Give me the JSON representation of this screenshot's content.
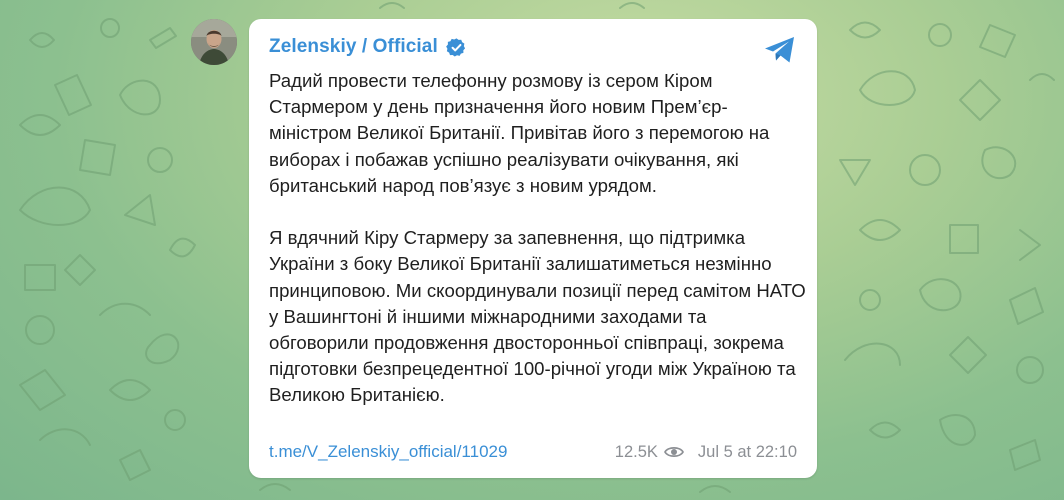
{
  "channel": {
    "name": "Zelenskiy / Official",
    "verified": true,
    "avatar_icon": "profile-photo",
    "accent_color": "#3a8fd6"
  },
  "post": {
    "paragraphs": [
      "Радий провести телефонну розмову із сером Кіром Стармером у день призначення його новим Прем’єр-міністром Великої Британії. Привітав його з перемогою на виборах і побажав успішно реалізувати очікування, які британський народ пов’язує з новим урядом.",
      "Я вдячний Кіру Стармеру за запевнення, що підтримка України з боку Великої Британії залишатиметься незмінно принциповою. Ми скоординували позиції перед самітом НАТО у Вашингтоні й іншими міжнародними заходами та обговорили продовження двосторонньої співпраці, зокрема підготовки безпрецедентної 100-річної угоди між Україною та Великою Британією."
    ],
    "link": "t.me/V_Zelenskiy_official/11029",
    "views": "12.5K",
    "date": "Jul 5 at 22:10"
  },
  "icons": {
    "verified": "verified-badge-icon",
    "share": "telegram-share-icon",
    "views": "eye-icon"
  },
  "colors": {
    "background": "#a9cd94",
    "card": "#ffffff",
    "text": "#1f1f1f",
    "meta": "#8c8f94"
  }
}
